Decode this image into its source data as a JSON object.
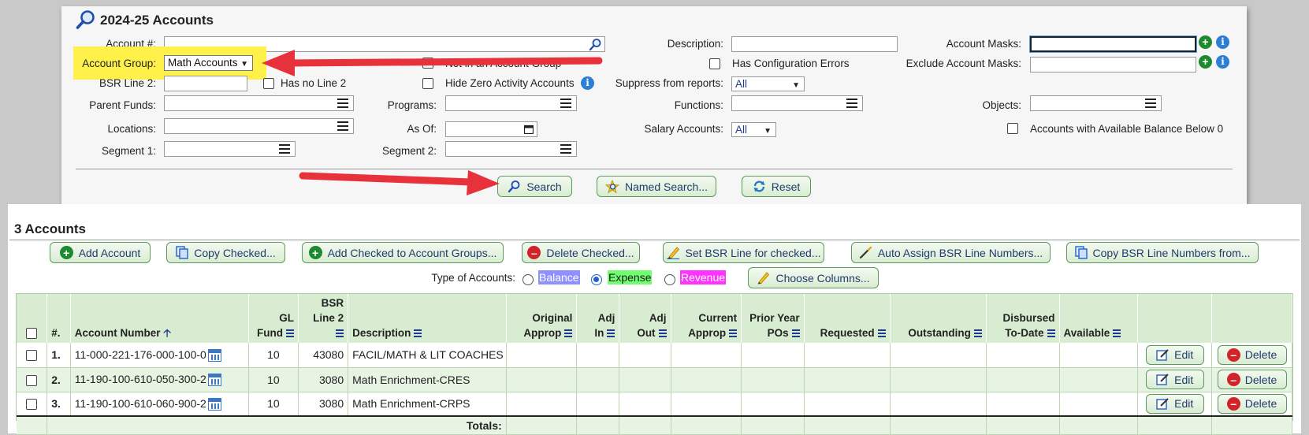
{
  "search_panel": {
    "title": "2024-25 Accounts",
    "labels": {
      "account_number": "Account #:",
      "account_group": "Account Group:",
      "bsr_line_2": "BSR Line 2:",
      "parent_funds": "Parent Funds:",
      "locations": "Locations:",
      "segment_1": "Segment 1:",
      "programs": "Programs:",
      "as_of": "As Of:",
      "segment_2": "Segment 2:",
      "description": "Description:",
      "functions": "Functions:",
      "suppress_from_reports": "Suppress from reports:",
      "salary_accounts": "Salary Accounts:",
      "account_masks": "Account Masks:",
      "exclude_account_masks": "Exclude Account Masks:",
      "objects": "Objects:"
    },
    "checkboxes": {
      "has_no_line_2": "Has no Line 2",
      "not_in_account_group": "Not in an Account Group",
      "hide_zero_activity": "Hide Zero Activity Accounts",
      "has_configuration_errors": "Has Configuration Errors",
      "accounts_below_zero": "Accounts with Available Balance Below 0"
    },
    "values": {
      "account_group": "Math Accounts",
      "suppress_from_reports": "All",
      "salary_accounts": "All"
    },
    "buttons": {
      "search": "Search",
      "named_search": "Named Search...",
      "reset": "Reset"
    }
  },
  "accounts": {
    "title": "3 Accounts",
    "toolbar": {
      "add_account": "Add Account",
      "copy_checked": "Copy Checked...",
      "add_to_groups": "Add Checked to Account Groups...",
      "delete_checked": "Delete Checked...",
      "set_bsr_line": "Set BSR Line for checked...",
      "auto_assign_bsr": "Auto Assign BSR Line Numbers...",
      "copy_bsr": "Copy BSR Line Numbers from..."
    },
    "type_label": "Type of Accounts:",
    "types": {
      "balance": "Balance",
      "expense": "Expense",
      "revenue": "Revenue",
      "selected": "Expense"
    },
    "choose_columns": "Choose Columns...",
    "colors": {
      "balance_bg": "#8f8fff",
      "expense_bg": "#6fff6f",
      "revenue_bg": "#ff33ff"
    },
    "columns": {
      "num": "#.",
      "account_number": "Account Number",
      "gl_fund_1": "GL",
      "gl_fund_2": "Fund",
      "bsr_1": "BSR",
      "bsr_2": "Line 2",
      "description": "Description",
      "original_1": "Original",
      "original_2": "Approp",
      "adj_in_1": "Adj",
      "adj_in_2": "In",
      "adj_out_1": "Adj",
      "adj_out_2": "Out",
      "current_1": "Current",
      "current_2": "Approp",
      "prior_1": "Prior Year",
      "prior_2": "POs",
      "requested": "Requested",
      "outstanding": "Outstanding",
      "disbursed_1": "Disbursed",
      "disbursed_2": "To-Date",
      "available": "Available"
    },
    "rows": [
      {
        "num": "1.",
        "account": "11-000-221-176-000-100-0",
        "gl_fund": "10",
        "bsr": "43080",
        "description": "FACIL/MATH & LIT COACHES"
      },
      {
        "num": "2.",
        "account": "11-190-100-610-050-300-2",
        "gl_fund": "10",
        "bsr": "3080",
        "description": "Math Enrichment-CRES"
      },
      {
        "num": "3.",
        "account": "11-190-100-610-060-900-2",
        "gl_fund": "10",
        "bsr": "3080",
        "description": "Math Enrichment-CRPS"
      }
    ],
    "row_buttons": {
      "edit": "Edit",
      "delete": "Delete"
    },
    "totals_label": "Totals:"
  },
  "annotation_color": "#e8323b",
  "highlight_color": "#fff14a"
}
